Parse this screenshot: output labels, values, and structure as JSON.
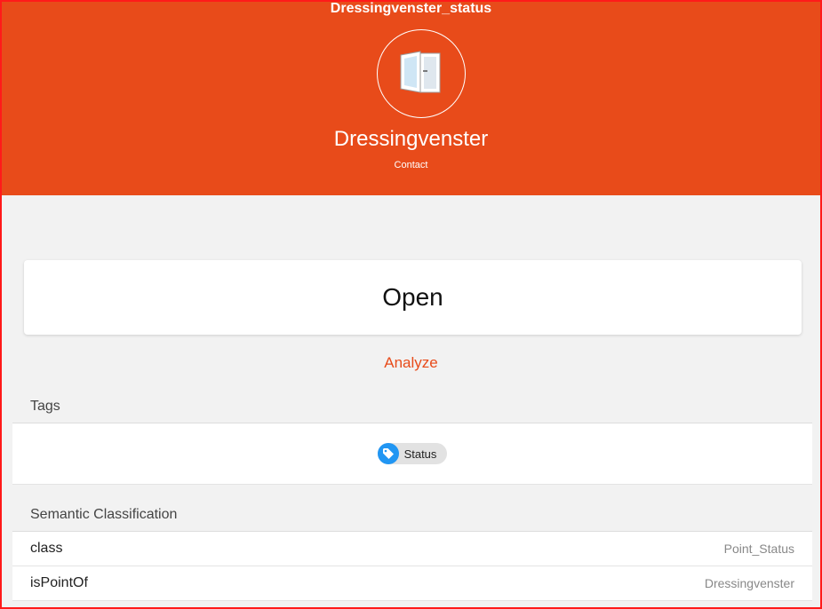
{
  "header": {
    "item_name": "Dressingvenster_status",
    "title": "Dressingvenster",
    "subtitle": "Contact",
    "icon": "window-open-icon",
    "background": "#e84b1a"
  },
  "state": {
    "value": "Open"
  },
  "analyze_label": "Analyze",
  "tags": {
    "title": "Tags",
    "items": [
      {
        "label": "Status",
        "icon": "tag-icon"
      }
    ]
  },
  "semantic": {
    "title": "Semantic Classification",
    "rows": [
      {
        "key": "class",
        "value": "Point_Status"
      },
      {
        "key": "isPointOf",
        "value": "Dressingvenster"
      }
    ]
  }
}
